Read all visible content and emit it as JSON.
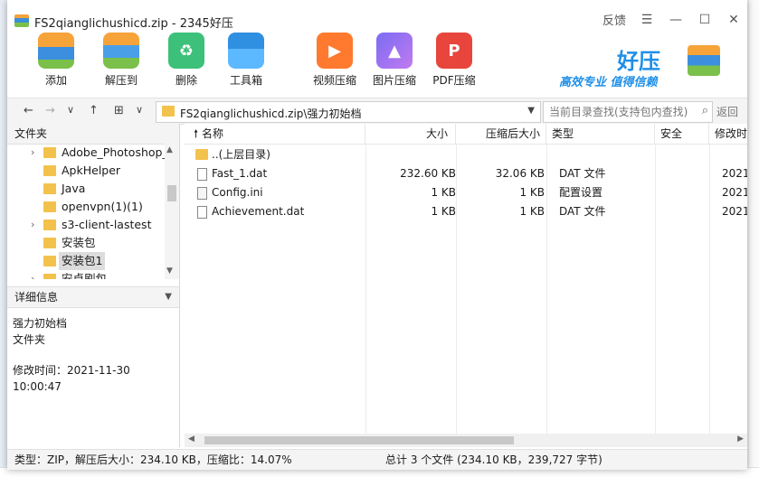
{
  "window": {
    "title": "FS2qianglichushicd.zip - 2345好压",
    "feedback": "反馈",
    "menu_glyph": "☰",
    "min_glyph": "—",
    "max_glyph": "☐",
    "close_glyph": "✕"
  },
  "toolbar": {
    "items": [
      {
        "label": "添加",
        "icon": "add-icon"
      },
      {
        "label": "解压到",
        "icon": "extract-icon"
      },
      {
        "label": "删除",
        "icon": "delete-icon"
      },
      {
        "label": "工具箱",
        "icon": "toolbox-icon"
      },
      {
        "label": "视频压缩",
        "icon": "video-compress-icon"
      },
      {
        "label": "图片压缩",
        "icon": "image-compress-icon"
      },
      {
        "label": "PDF压缩",
        "icon": "pdf-compress-icon"
      }
    ],
    "brand_name": "好压",
    "brand_slogan": "高效专业 值得信赖"
  },
  "address": {
    "path": "FS2qianglichushicd.zip\\强力初始档",
    "search_placeholder": "当前目录查找(支持包内查找)",
    "back_label": "返回",
    "nav_back": "←",
    "nav_forward": "→",
    "nav_down": "∨",
    "nav_up": "↑",
    "view_toggle": "⊞",
    "view_dropdown": "∨"
  },
  "sidebar": {
    "header": "文件夹",
    "tree": [
      {
        "label": "Adobe_Photoshop_",
        "expandable": true
      },
      {
        "label": "ApkHelper",
        "expandable": false
      },
      {
        "label": "Java",
        "expandable": false
      },
      {
        "label": "openvpn(1)(1)",
        "expandable": false
      },
      {
        "label": "s3-client-lastest",
        "expandable": true
      },
      {
        "label": "安装包",
        "expandable": false
      },
      {
        "label": "安装包1",
        "expandable": false,
        "selected": true
      },
      {
        "label": "安卓刷包",
        "expandable": true
      }
    ],
    "detail_header": "详细信息",
    "detail_name": "强力初始档",
    "detail_type": "文件夹",
    "detail_modified": "修改时间：2021-11-30 10:00:47"
  },
  "list": {
    "columns": [
      "名称",
      "大小",
      "压缩后大小",
      "类型",
      "安全",
      "修改时"
    ],
    "rows": [
      {
        "name": "..(上层目录)",
        "size": "",
        "packed": "",
        "type": "",
        "security": "",
        "modified": "",
        "kind": "folder"
      },
      {
        "name": "Fast_1.dat",
        "size": "232.60 KB",
        "packed": "32.06 KB",
        "type": "DAT 文件",
        "security": "",
        "modified": "2021-",
        "kind": "file"
      },
      {
        "name": "Config.ini",
        "size": "1 KB",
        "packed": "1 KB",
        "type": "配置设置",
        "security": "",
        "modified": "2021-",
        "kind": "config"
      },
      {
        "name": "Achievement.dat",
        "size": "1 KB",
        "packed": "1 KB",
        "type": "DAT 文件",
        "security": "",
        "modified": "2021-",
        "kind": "file"
      }
    ]
  },
  "status": {
    "left": "类型：ZIP，解压后大小：234.10 KB，压缩比：14.07%",
    "right": "总计 3 个文件 (234.10 KB，239,727 字节)"
  }
}
